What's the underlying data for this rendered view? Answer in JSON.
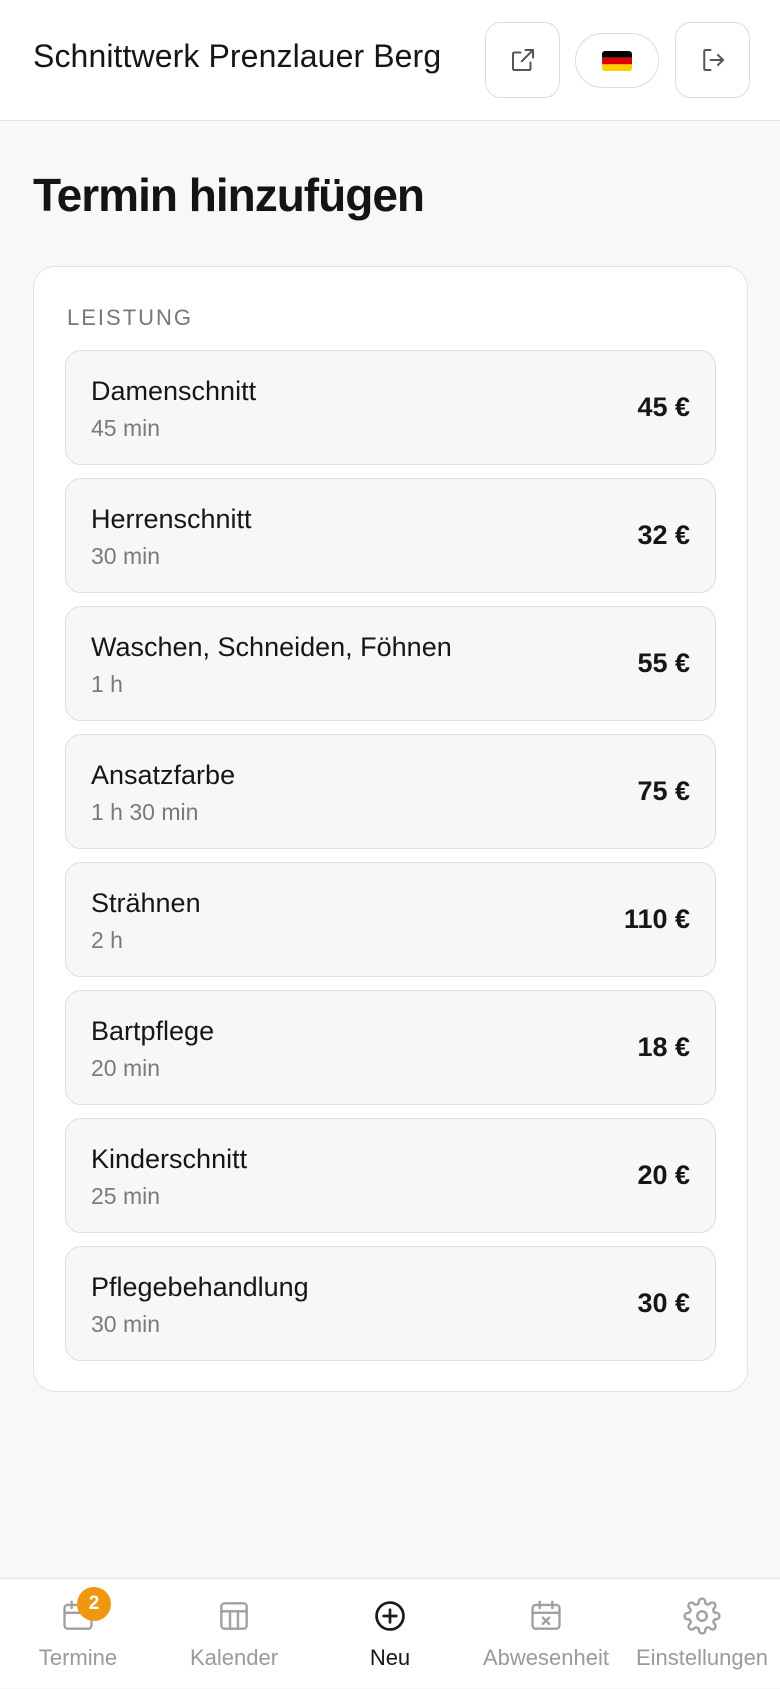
{
  "header": {
    "title": "Schnittwerk Prenzlauer Berg",
    "language_flag": "de-flag"
  },
  "page": {
    "title": "Termin hinzufügen",
    "section_label": "LEISTUNG"
  },
  "services": [
    {
      "name": "Damenschnitt",
      "duration": "45 min",
      "price": "45 €"
    },
    {
      "name": "Herrenschnitt",
      "duration": "30 min",
      "price": "32 €"
    },
    {
      "name": "Waschen, Schneiden, Föhnen",
      "duration": "1 h",
      "price": "55 €"
    },
    {
      "name": "Ansatzfarbe",
      "duration": "1 h 30 min",
      "price": "75 €"
    },
    {
      "name": "Strähnen",
      "duration": "2 h",
      "price": "110 €"
    },
    {
      "name": "Bartpflege",
      "duration": "20 min",
      "price": "18 €"
    },
    {
      "name": "Kinderschnitt",
      "duration": "25 min",
      "price": "20 €"
    },
    {
      "name": "Pflegebehandlung",
      "duration": "30 min",
      "price": "30 €"
    }
  ],
  "nav": {
    "items": [
      {
        "label": "Termine",
        "icon": "calendar-icon",
        "badge": "2"
      },
      {
        "label": "Kalender",
        "icon": "calendar-grid-icon"
      },
      {
        "label": "Neu",
        "icon": "plus-circle-icon",
        "active": true
      },
      {
        "label": "Abwesenheit",
        "icon": "calendar-x-icon"
      },
      {
        "label": "Einstellungen",
        "icon": "gear-icon"
      }
    ]
  },
  "colors": {
    "accent_badge": "#f0960f",
    "text_primary": "#161616",
    "text_muted": "#7a7a7a",
    "background": "#f8f8f8"
  }
}
